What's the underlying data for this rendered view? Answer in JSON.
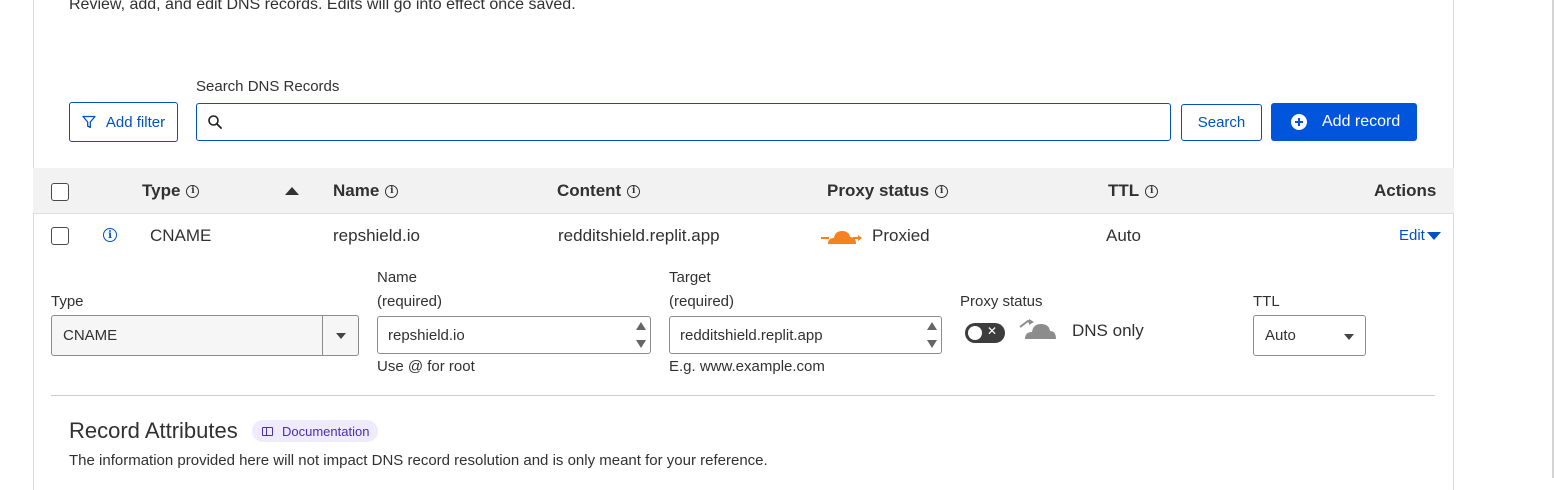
{
  "intro": {
    "description": "Review, add, and edit DNS records. Edits will go into effect once saved."
  },
  "toolbar": {
    "add_filter_label": "Add filter",
    "search_label": "Search DNS Records",
    "search_value": "",
    "search_button_label": "Search",
    "add_record_label": "Add record"
  },
  "table": {
    "headers": {
      "type": "Type",
      "name": "Name",
      "content": "Content",
      "proxy_status": "Proxy status",
      "ttl": "TTL",
      "actions": "Actions"
    },
    "rows": [
      {
        "type": "CNAME",
        "name": "repshield.io",
        "content": "redditshield.replit.app",
        "proxy_status": "Proxied",
        "ttl": "Auto",
        "action_label": "Edit"
      }
    ]
  },
  "edit_form": {
    "type_label": "Type",
    "type_value": "CNAME",
    "name_label": "Name",
    "name_required": "(required)",
    "name_value": "repshield.io",
    "name_hint": "Use @ for root",
    "target_label": "Target",
    "target_required": "(required)",
    "target_value": "redditshield.replit.app",
    "target_hint": "E.g. www.example.com",
    "proxy_label": "Proxy status",
    "proxy_value": "DNS only",
    "proxy_toggle_on": false,
    "ttl_label": "TTL",
    "ttl_value": "Auto"
  },
  "record_attributes": {
    "title": "Record Attributes",
    "doc_badge": "Documentation",
    "description": "The information provided here will not impact DNS record resolution and is only meant for your reference."
  },
  "colors": {
    "brand_blue": "#0055dc",
    "link_blue": "#0051c3",
    "proxied_orange": "#f6821f",
    "dns_only_grey": "#8c8c8c"
  }
}
